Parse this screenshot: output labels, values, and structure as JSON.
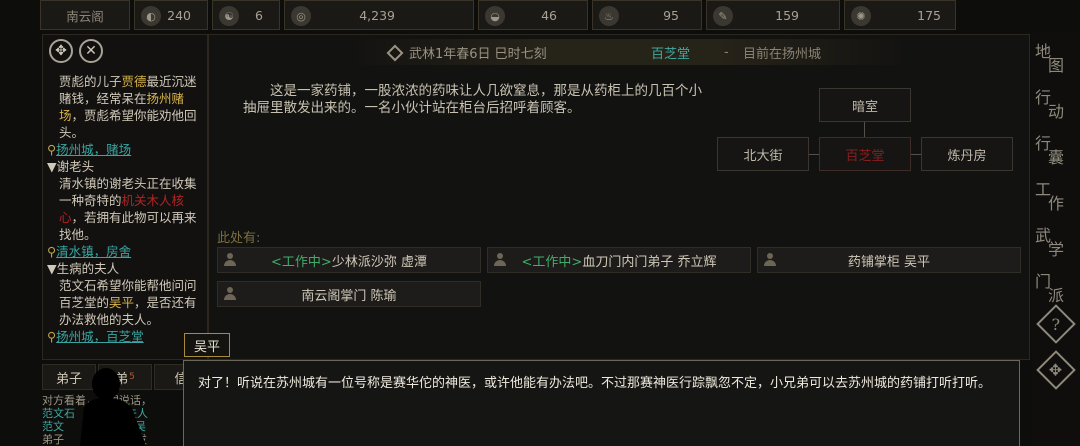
{
  "topbar": {
    "sect_name": "南云阁",
    "stats": [
      {
        "icon": "reputation-icon",
        "glyph": "◐",
        "value": "240"
      },
      {
        "icon": "yinyang-icon",
        "glyph": "☯",
        "value": "6"
      },
      {
        "icon": "coin-icon",
        "glyph": "◎",
        "value": "4,239"
      },
      {
        "icon": "food-bowl-icon",
        "glyph": "◒",
        "value": "46"
      },
      {
        "icon": "herb-icon",
        "glyph": "♨",
        "value": "95"
      },
      {
        "icon": "brush-icon",
        "glyph": "✎",
        "value": "159"
      },
      {
        "icon": "tiger-icon",
        "glyph": "✺",
        "value": "175"
      }
    ]
  },
  "quest_panel": {
    "q1_text_a": "贾彪的儿子",
    "q1_name": "贾德",
    "q1_text_b": "最近沉迷赌钱，经常呆在",
    "q1_place": "扬州赌场",
    "q1_text_c": "，贾彪希望你能劝他回头。",
    "q1_link": "扬州城，赌场",
    "q2_title": "▼谢老头",
    "q2_text_a": "清水镇的谢老头正在收集一种奇特的",
    "q2_item": "机关木人核心",
    "q2_text_b": "，若拥有此物可以再来找他。",
    "q2_link": "清水镇，房舍",
    "q3_title": "▼生病的夫人",
    "q3_text_a": "范文石希望你能帮他问问百芝堂的",
    "q3_name": "吴平",
    "q3_text_b": "，是否还有办法救他的夫人。",
    "q3_link": "扬州城，百芝堂"
  },
  "header": {
    "date": "武林1年春6日 巳时七刻",
    "location": "百芝堂",
    "dash": "-",
    "current": "目前在扬州城"
  },
  "description": "这是一家药铺，一股浓浓的药味让人几欲窒息，那是从药柜上的几百个小抽屉里散发出来的。一名小伙计站在柜台后招呼着顾客。",
  "map": {
    "north": "暗室",
    "west": "北大街",
    "center": "百芝堂",
    "east": "炼丹房"
  },
  "here_label": "此处有:",
  "npcs": [
    {
      "tag": "<工作中>",
      "name": "少林派沙弥 虚潭"
    },
    {
      "tag": "<工作中>",
      "name": "血刀门内门弟子 乔立辉"
    },
    {
      "tag": "",
      "name": "药铺掌柜 吴平"
    },
    {
      "tag": "",
      "name": "南云阁掌门 陈瑜"
    }
  ],
  "side_buttons": [
    {
      "icon": "map-icon",
      "chars": [
        "地",
        "图"
      ]
    },
    {
      "icon": "action-icon",
      "chars": [
        "行",
        "动"
      ]
    },
    {
      "icon": "bag-icon",
      "chars": [
        "行",
        "囊"
      ]
    },
    {
      "icon": "work-icon",
      "chars": [
        "工",
        "作"
      ]
    },
    {
      "icon": "martial-icon",
      "chars": [
        "武",
        "学"
      ]
    },
    {
      "icon": "sect-icon",
      "chars": [
        "门",
        "派"
      ]
    },
    {
      "icon": "help-icon",
      "chars": [
        "?"
      ]
    },
    {
      "icon": "settings-icon",
      "chars": [
        "✥"
      ]
    }
  ],
  "tabs": {
    "disciple": "弟子",
    "mid": "弟",
    "mid_sub": "5",
    "letter": "信"
  },
  "chat": {
    "line1": "对方看着，不想说话，",
    "line2a": "范文石",
    "line2b": "客夫人",
    "line3a": "范文",
    "line3b": "今吴",
    "line4a": "弟子",
    "line4b": "发"
  },
  "speaker": "吴平",
  "dialogue": "对了！听说在苏州城有一位号称是赛华佗的神医，或许他能有办法吧。不过那赛神医行踪飘忽不定，小兄弟可以去苏州城的药铺打听打听。"
}
